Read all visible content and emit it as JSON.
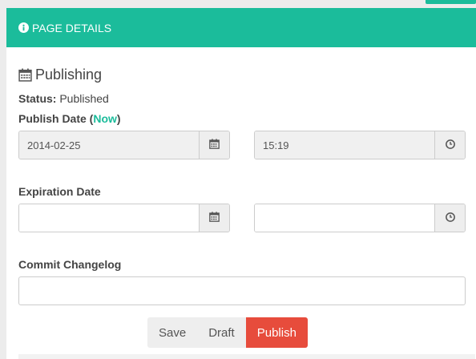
{
  "panel": {
    "title": "PAGE DETAILS",
    "header_color": "#1bbc9b",
    "header_icon": "info-icon"
  },
  "publishing": {
    "title": "Publishing",
    "title_icon": "calendar-icon",
    "status_label": "Status:",
    "status_value": "Published",
    "publish_date_label": "Publish Date (",
    "publish_date_now": "Now",
    "publish_date_close": ")",
    "publish_date_value": "2014-02-25",
    "publish_time_value": "15:19",
    "expiration_label": "Expiration Date",
    "expiration_date_value": "",
    "expiration_time_value": "",
    "changelog_label": "Commit Changelog",
    "changelog_value": ""
  },
  "actions": {
    "save_label": "Save",
    "draft_label": "Draft",
    "publish_label": "Publish",
    "publish_color": "#e74c3c"
  }
}
